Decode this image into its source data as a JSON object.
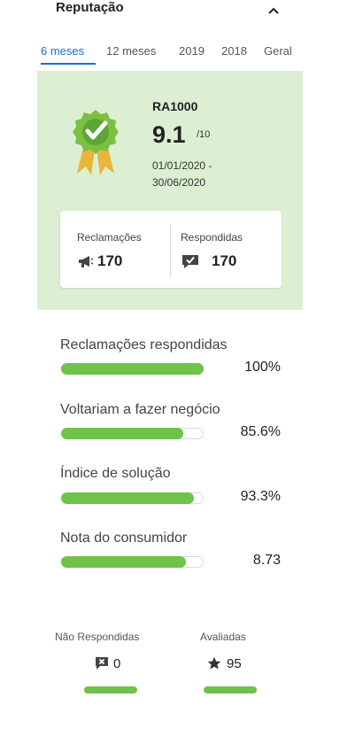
{
  "header": {
    "title": "Reputação"
  },
  "tabs": [
    {
      "label": "6 meses"
    },
    {
      "label": "12 meses"
    },
    {
      "label": "2019"
    },
    {
      "label": "2018"
    },
    {
      "label": "Geral"
    }
  ],
  "summary": {
    "badge": "RA1000",
    "score": "9.1",
    "score_max": "/10",
    "period_start": "01/01/2020 -",
    "period_end": "30/06/2020"
  },
  "stats": {
    "complaints_label": "Reclamações",
    "complaints_value": "170",
    "answered_label": "Respondidas",
    "answered_value": "170"
  },
  "metrics": [
    {
      "label": "Reclamações respondidas",
      "value": "100%",
      "fill_fraction": 1.0
    },
    {
      "label": "Voltariam a fazer negócio",
      "value": "85.6%",
      "fill_fraction": 0.856
    },
    {
      "label": "Índice de solução",
      "value": "93.3%",
      "fill_fraction": 0.933
    },
    {
      "label": "Nota do consumidor",
      "value": "8.73",
      "fill_fraction": 0.873
    }
  ],
  "bottom": {
    "unanswered_label": "Não Respondidas",
    "unanswered_value": "0",
    "rated_label": "Avaliadas",
    "rated_value": "95"
  },
  "colors": {
    "accent": "#1a6fd1",
    "panel": "#dcefd3",
    "bar": "#6fc24a"
  },
  "icons": {
    "collapse": "chevron-up-icon",
    "award": "award-ribbon-icon",
    "complaints": "megaphone-icon",
    "answered": "checked-chat-icon",
    "unanswered": "x-chat-icon",
    "rated": "star-icon"
  }
}
